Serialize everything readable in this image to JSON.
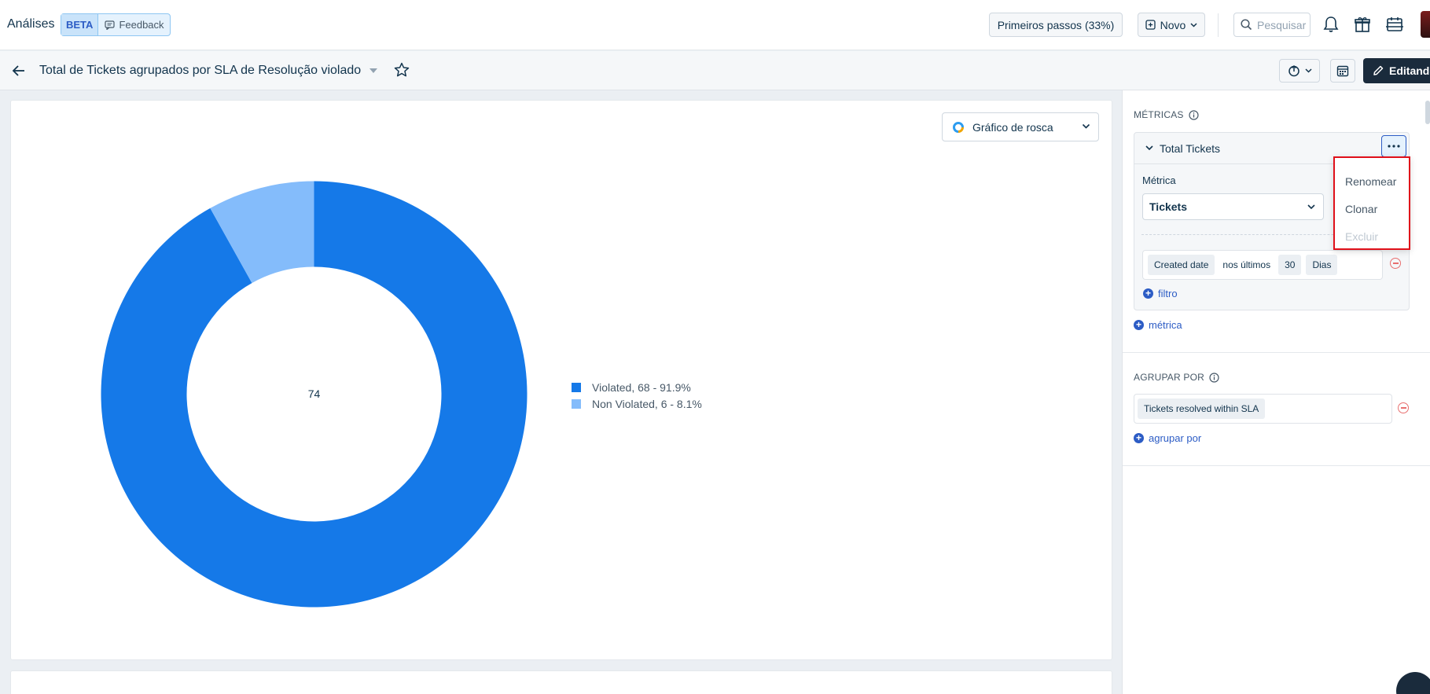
{
  "topbar": {
    "app_title": "Análises",
    "beta": "BETA",
    "feedback": "Feedback",
    "primeiros_passos": "Primeiros passos (33%)",
    "novo": "Novo",
    "search_placeholder": "Pesquisar"
  },
  "subbar": {
    "report_title": "Total de Tickets agrupados por SLA de Resolução violado",
    "edit_label": "Editando"
  },
  "chart_selector": {
    "label": "Gráfico de rosca"
  },
  "chart_data": {
    "type": "pie",
    "center_label": "74",
    "series": [
      {
        "name": "Violated",
        "value": 68,
        "percent": "91.9%",
        "color": "#1579e8",
        "legend": "Violated,  68 - 91.9%"
      },
      {
        "name": "Non Violated",
        "value": 6,
        "percent": "8.1%",
        "color": "#84bcfb",
        "legend": "Non Violated,  6 - 8.1%"
      }
    ]
  },
  "panel": {
    "metrics_title": "MÉTRICAS",
    "metric_name": "Total Tickets",
    "metric_label": "Métrica",
    "metric_value": "Tickets",
    "filter": {
      "field": "Created date",
      "operator": "nos últimos",
      "amount": "30",
      "unit": "Dias"
    },
    "add_filter": "filtro",
    "add_metric": "métrica",
    "group_title": "AGRUPAR POR",
    "group_value": "Tickets resolved within SLA",
    "add_group": "agrupar por"
  },
  "menu": {
    "items": [
      "Renomear",
      "Clonar",
      "Excluir"
    ]
  },
  "colors": {
    "accent": "#2c5cc5",
    "highlight": "#e0101a"
  }
}
